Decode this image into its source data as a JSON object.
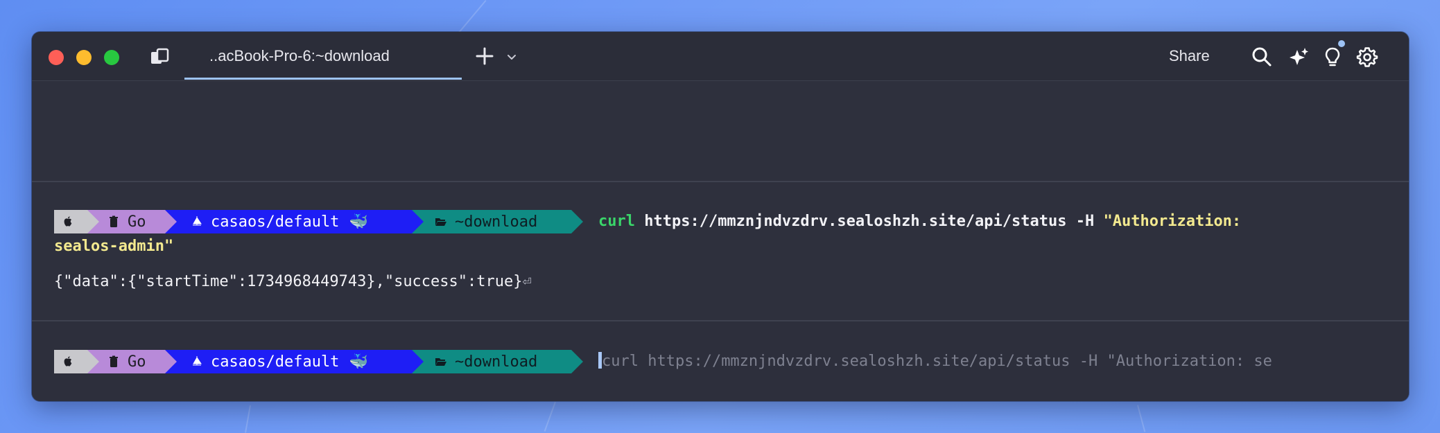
{
  "window": {
    "tab_title": "..acBook-Pro-6:~download",
    "share_label": "Share"
  },
  "icons": {
    "panels": "panels-icon",
    "new_tab": "plus-icon",
    "new_tab_menu": "chevron-down-icon",
    "search": "search-icon",
    "ai": "sparkle-icon",
    "tips": "lightbulb-icon",
    "settings": "gear-icon"
  },
  "colors": {
    "window_bg": "#2e303d",
    "accent": "#9ec3f5",
    "seg_apple": "#c8c8cc",
    "seg_go": "#b88ad9",
    "seg_k8s": "#1e1ef5",
    "seg_dir": "#0f8c84",
    "cmd_keyword": "#3ad66a",
    "cmd_string": "#f3e98f"
  },
  "prompt": {
    "go_label": "Go",
    "k8s_context": "casaos/default",
    "k8s_emoji": "🐳",
    "dir": "~download"
  },
  "block1": {
    "cmd_keyword": "curl",
    "cmd_args": " https://mmznjndvzdrv.sealoshzh.site/api/status -H ",
    "cmd_string_part1": "\"Authorization:",
    "cmd_string_part2": "sealos-admin\"",
    "output": "{\"data\":{\"startTime\":1734968449743},\"success\":true}",
    "output_end_glyph": "⏎"
  },
  "block2": {
    "cursor_char": "c",
    "autosuggest": "url https://mmznjndvzdrv.sealoshzh.site/api/status -H \"Authorization: se"
  }
}
